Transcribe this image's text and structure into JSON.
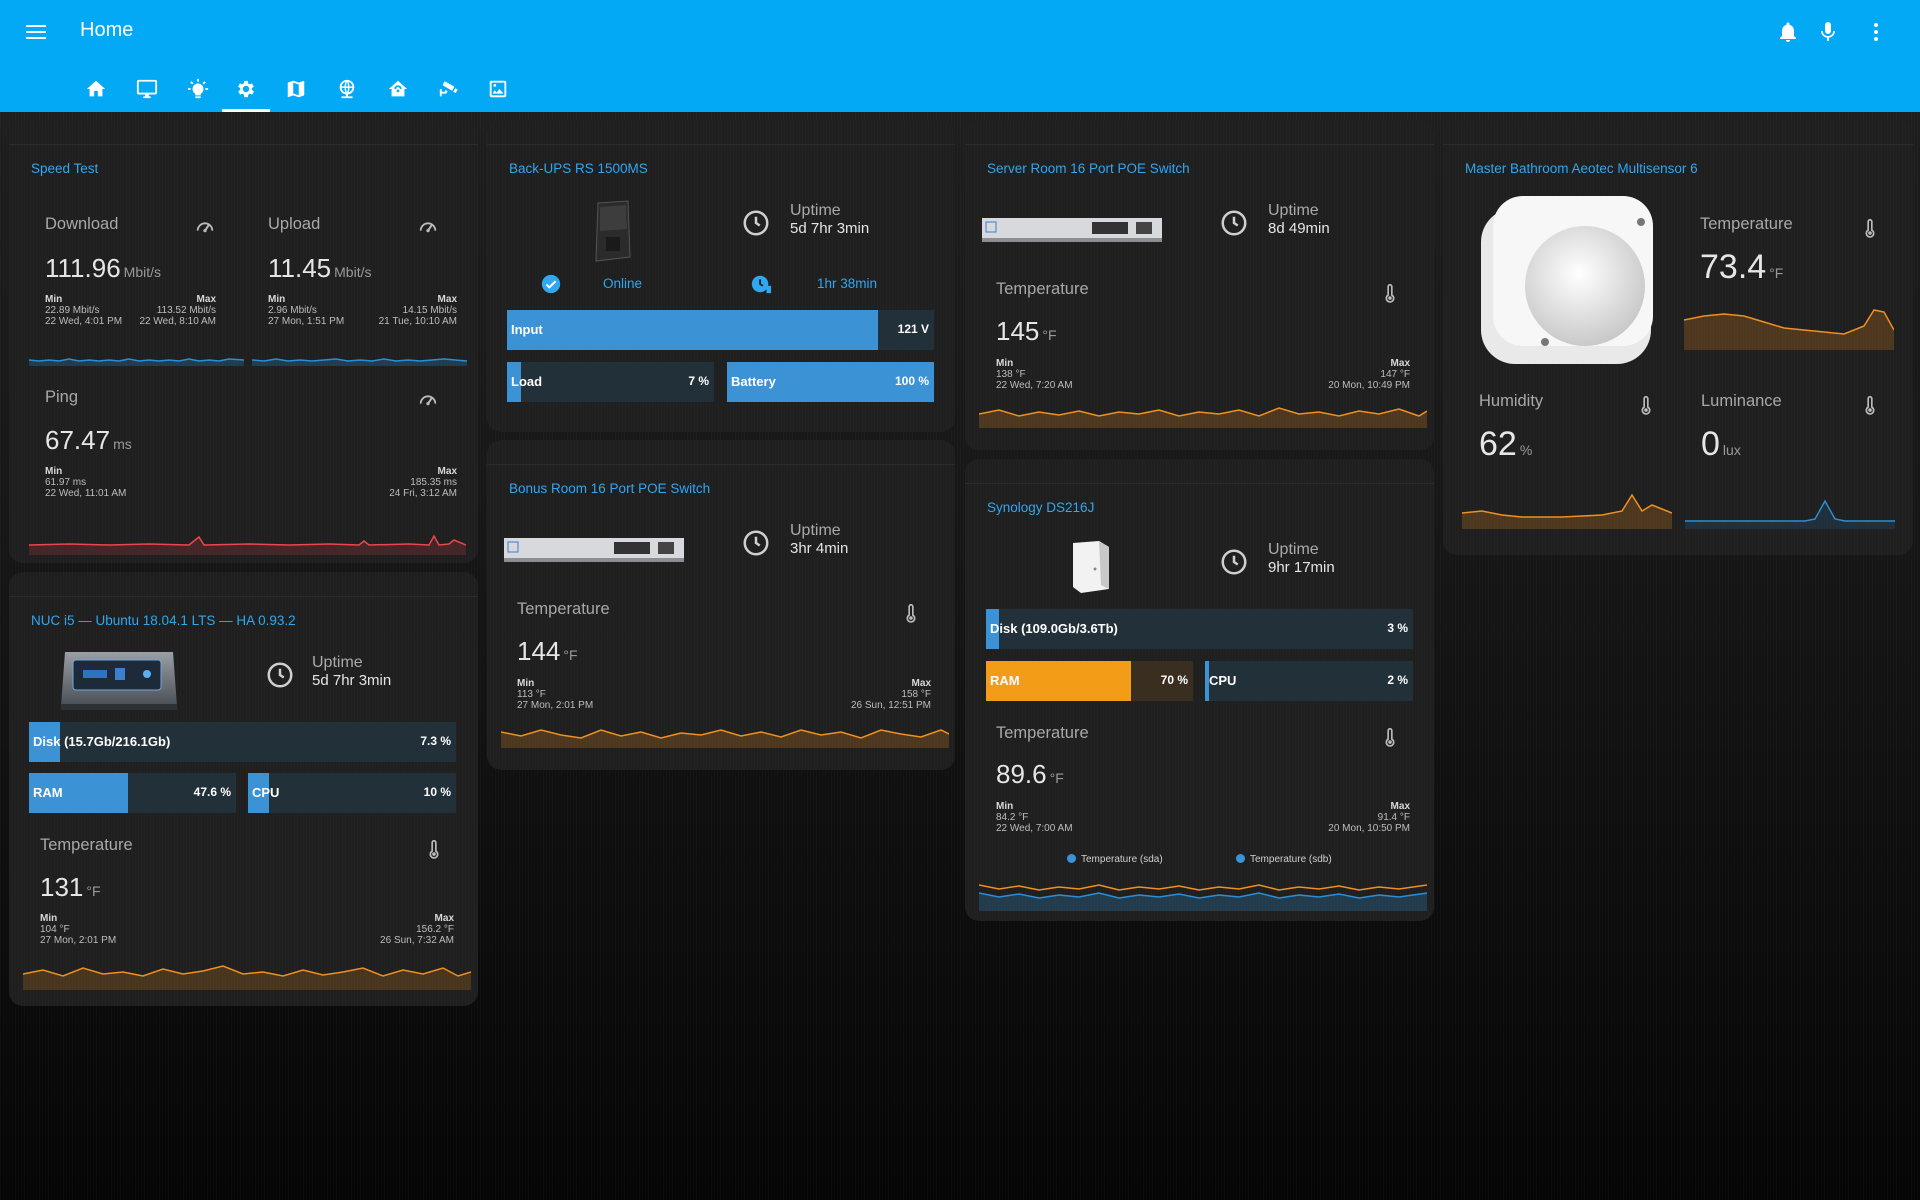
{
  "header": {
    "title": "Home",
    "tabs": [
      "home-icon",
      "monitor-icon",
      "lightbulb-icon",
      "settings-icon",
      "map-icon",
      "network-icon",
      "home-automation-icon",
      "cctv-icon",
      "image-icon"
    ],
    "active_tab": "settings-icon",
    "actions": [
      "bell-icon",
      "microphone-icon",
      "more-vert-icon"
    ]
  },
  "speedtest": {
    "title": "Speed Test",
    "download": {
      "label": "Download",
      "value": "111.96",
      "unit": "Mbit/s",
      "min_label": "Min",
      "min_val": "22.89 Mbit/s",
      "min_time": "22 Wed, 4:01 PM",
      "max_label": "Max",
      "max_val": "113.52 Mbit/s",
      "max_time": "22 Wed, 8:10 AM"
    },
    "upload": {
      "label": "Upload",
      "value": "11.45",
      "unit": "Mbit/s",
      "min_label": "Min",
      "min_val": "2.96 Mbit/s",
      "min_time": "27 Mon, 1:51 PM",
      "max_label": "Max",
      "max_val": "14.15 Mbit/s",
      "max_time": "21 Tue, 10:10 AM"
    },
    "ping": {
      "label": "Ping",
      "value": "67.47",
      "unit": "ms",
      "min_label": "Min",
      "min_val": "61.97 ms",
      "min_time": "22 Wed, 11:01 AM",
      "max_label": "Max",
      "max_val": "185.35 ms",
      "max_time": "24 Fri, 3:12 AM"
    }
  },
  "nuc": {
    "title": "NUC i5 — Ubuntu 18.04.1 LTS — HA 0.93.2",
    "uptime_label": "Uptime",
    "uptime": "5d 7hr 3min",
    "disk": {
      "label": "Disk (15.7Gb/216.1Gb)",
      "value": "7.3 %",
      "pct": 7.3
    },
    "ram": {
      "label": "RAM",
      "value": "47.6 %",
      "pct": 47.6
    },
    "cpu": {
      "label": "CPU",
      "value": "10 %",
      "pct": 10
    },
    "temp": {
      "label": "Temperature",
      "value": "131",
      "unit": "°F",
      "min_label": "Min",
      "min_val": "104 °F",
      "min_time": "27 Mon, 2:01 PM",
      "max_label": "Max",
      "max_val": "156.2 °F",
      "max_time": "26 Sun, 7:32 AM"
    }
  },
  "ups": {
    "title": "Back-UPS RS 1500MS",
    "uptime_label": "Uptime",
    "uptime": "5d 7hr 3min",
    "status": "Online",
    "runtime": "1hr 38min",
    "input": {
      "label": "Input",
      "value": "121 V",
      "pct": 87
    },
    "load": {
      "label": "Load",
      "value": "7 %",
      "pct": 7
    },
    "battery": {
      "label": "Battery",
      "value": "100 %",
      "pct": 100
    }
  },
  "bonus_switch": {
    "title": "Bonus Room 16 Port POE Switch",
    "uptime_label": "Uptime",
    "uptime": "3hr 4min",
    "temp": {
      "label": "Temperature",
      "value": "144",
      "unit": "°F",
      "min_label": "Min",
      "min_val": "113 °F",
      "min_time": "27 Mon, 2:01 PM",
      "max_label": "Max",
      "max_val": "158 °F",
      "max_time": "26 Sun, 12:51 PM"
    }
  },
  "server_switch": {
    "title": "Server Room 16 Port POE Switch",
    "uptime_label": "Uptime",
    "uptime": "8d 49min",
    "temp": {
      "label": "Temperature",
      "value": "145",
      "unit": "°F",
      "min_label": "Min",
      "min_val": "138 °F",
      "min_time": "22 Wed, 7:20 AM",
      "max_label": "Max",
      "max_val": "147 °F",
      "max_time": "20 Mon, 10:49 PM"
    }
  },
  "synology": {
    "title": "Synology DS216J",
    "uptime_label": "Uptime",
    "uptime": "9hr 17min",
    "disk": {
      "label": "Disk (109.0Gb/3.6Tb)",
      "value": "3 %",
      "pct": 3
    },
    "ram": {
      "label": "RAM",
      "value": "70 %",
      "pct": 70
    },
    "cpu": {
      "label": "CPU",
      "value": "2 %",
      "pct": 2
    },
    "temp": {
      "label": "Temperature",
      "value": "89.6",
      "unit": "°F",
      "min_label": "Min",
      "min_val": "84.2 °F",
      "min_time": "22 Wed, 7:00 AM",
      "max_label": "Max",
      "max_val": "91.4 °F",
      "max_time": "20 Mon, 10:50 PM"
    },
    "legend": [
      "Temperature (sda)",
      "Temperature (sdb)"
    ]
  },
  "multisensor": {
    "title": "Master Bathroom Aeotec Multisensor 6",
    "temperature": {
      "label": "Temperature",
      "value": "73.4",
      "unit": "°F"
    },
    "humidity": {
      "label": "Humidity",
      "value": "62",
      "unit": "%"
    },
    "luminance": {
      "label": "Luminance",
      "value": "0",
      "unit": "lux"
    }
  },
  "colors": {
    "header": "#03a9f4",
    "accent": "#2fa7f1",
    "bar_blue": "#3b93d6",
    "bar_orange": "#f39c17",
    "spark_orange": "#f0901f",
    "spark_red": "#e8484e",
    "spark_blue": "#2b8fd6"
  }
}
